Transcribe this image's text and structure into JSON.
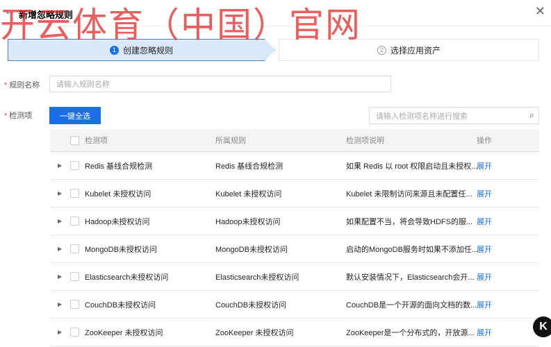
{
  "watermark": "开云体育（中国）官网",
  "header": {
    "title": "新增忽略规则"
  },
  "steps": [
    {
      "num": "1",
      "label": "创建忽略规则",
      "active": true
    },
    {
      "num": "2",
      "label": "选择应用资产",
      "active": false
    }
  ],
  "form": {
    "name_label": "规则名称",
    "name_placeholder": "请输入规则名称",
    "items_label": "检测项",
    "select_all": "一键全选",
    "search_placeholder": "请输入检测项名称进行搜索"
  },
  "table": {
    "headers": [
      "检测项",
      "所属规则",
      "检测项说明",
      "操作"
    ],
    "rows": [
      {
        "item": "Redis 基线合规检测",
        "rule": "Redis 基线合规检测",
        "desc": "如果 Redis 以 root 权限启动且未授权...",
        "action": "展开"
      },
      {
        "item": "Kubelet 未授权访问",
        "rule": "Kubelet 未授权访问",
        "desc": "Kubelet 未限制访问来源且未配置任...",
        "action": "展开"
      },
      {
        "item": "Hadoop未授权访问",
        "rule": "Hadoop未授权访问",
        "desc": "如果配置不当，将会导致HDFS的服...",
        "action": "展开"
      },
      {
        "item": "MongoDB未授权访问",
        "rule": "MongoDB未授权访问",
        "desc": "启动的MongoDB服务时如果不添加任...",
        "action": "展开"
      },
      {
        "item": "Elasticsearch未授权访问",
        "rule": "Elasticsearch未授权访问",
        "desc": "默认安装情况下，Elasticsearch会开...",
        "action": "展开"
      },
      {
        "item": "CouchDB未授权访问",
        "rule": "CouchDB未授权访问",
        "desc": "CouchDB是一个开源的面向文档的数...",
        "action": "展开"
      },
      {
        "item": "ZooKeeper 未授权访问",
        "rule": "ZooKeeper 未授权访问",
        "desc": "ZooKeeper是一个分布式的，开放源...",
        "action": "展开"
      }
    ]
  },
  "colors": {
    "primary": "#1a6fe8",
    "required": "#e54545",
    "watermark": "#e62828"
  }
}
